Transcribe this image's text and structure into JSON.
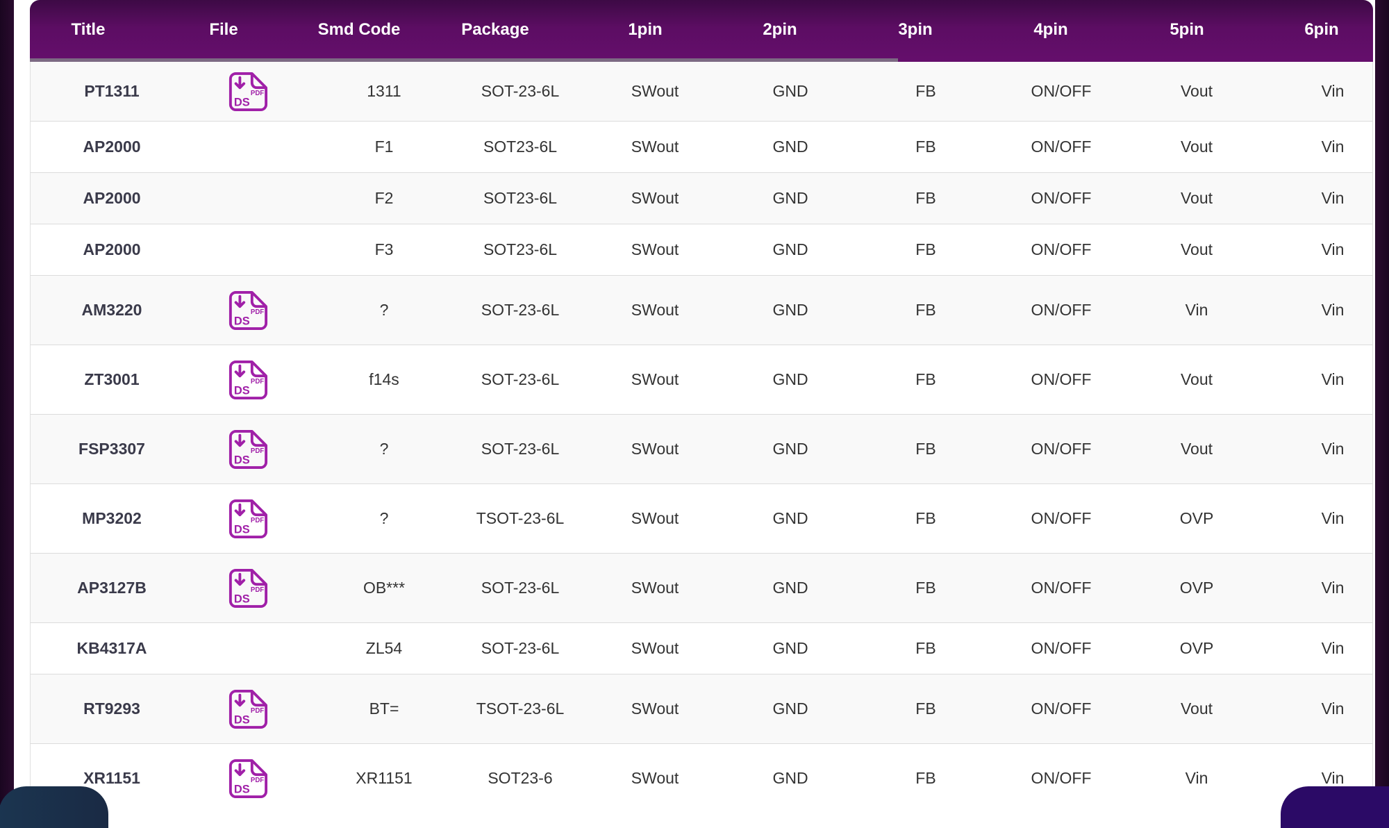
{
  "table": {
    "headers": [
      "Title",
      "File",
      "Smd Code",
      "Package",
      "1pin",
      "2pin",
      "3pin",
      "4pin",
      "5pin",
      "6pin"
    ],
    "file_icon": {
      "icon": "pdf-datasheet-download-icon",
      "label_top": "PDF",
      "label_bottom": "DS",
      "color": "#a020a8"
    },
    "rows": [
      {
        "title": "PT1311",
        "has_file": true,
        "smd": "1311",
        "package": "SOT-23-6L",
        "p1": "SWout",
        "p2": "GND",
        "p3": "FB",
        "p4": "ON/OFF",
        "p5": "Vout",
        "p6": "Vin"
      },
      {
        "title": "AP2000",
        "has_file": false,
        "smd": "F1",
        "package": "SOT23-6L",
        "p1": "SWout",
        "p2": "GND",
        "p3": "FB",
        "p4": "ON/OFF",
        "p5": "Vout",
        "p6": "Vin"
      },
      {
        "title": "AP2000",
        "has_file": false,
        "smd": "F2",
        "package": "SOT23-6L",
        "p1": "SWout",
        "p2": "GND",
        "p3": "FB",
        "p4": "ON/OFF",
        "p5": "Vout",
        "p6": "Vin"
      },
      {
        "title": "AP2000",
        "has_file": false,
        "smd": "F3",
        "package": "SOT23-6L",
        "p1": "SWout",
        "p2": "GND",
        "p3": "FB",
        "p4": "ON/OFF",
        "p5": "Vout",
        "p6": "Vin"
      },
      {
        "title": "AM3220",
        "has_file": true,
        "smd": "?",
        "package": "SOT-23-6L",
        "p1": "SWout",
        "p2": "GND",
        "p3": "FB",
        "p4": "ON/OFF",
        "p5": "Vin",
        "p6": "Vin"
      },
      {
        "title": "ZT3001",
        "has_file": true,
        "smd": "f14s",
        "package": "SOT-23-6L",
        "p1": "SWout",
        "p2": "GND",
        "p3": "FB",
        "p4": "ON/OFF",
        "p5": "Vout",
        "p6": "Vin"
      },
      {
        "title": "FSP3307",
        "has_file": true,
        "smd": "?",
        "package": "SOT-23-6L",
        "p1": "SWout",
        "p2": "GND",
        "p3": "FB",
        "p4": "ON/OFF",
        "p5": "Vout",
        "p6": "Vin"
      },
      {
        "title": "MP3202",
        "has_file": true,
        "smd": "?",
        "package": "TSOT-23-6L",
        "p1": "SWout",
        "p2": "GND",
        "p3": "FB",
        "p4": "ON/OFF",
        "p5": "OVP",
        "p6": "Vin"
      },
      {
        "title": "AP3127B",
        "has_file": true,
        "smd": "OB***",
        "package": "SOT-23-6L",
        "p1": "SWout",
        "p2": "GND",
        "p3": "FB",
        "p4": "ON/OFF",
        "p5": "OVP",
        "p6": "Vin"
      },
      {
        "title": "KB4317A",
        "has_file": false,
        "smd": "ZL54",
        "package": "SOT-23-6L",
        "p1": "SWout",
        "p2": "GND",
        "p3": "FB",
        "p4": "ON/OFF",
        "p5": "OVP",
        "p6": "Vin"
      },
      {
        "title": "RT9293",
        "has_file": true,
        "smd": "BT=",
        "package": "TSOT-23-6L",
        "p1": "SWout",
        "p2": "GND",
        "p3": "FB",
        "p4": "ON/OFF",
        "p5": "Vout",
        "p6": "Vin"
      },
      {
        "title": "XR1151",
        "has_file": true,
        "smd": "XR1151",
        "package": "SOT23-6",
        "p1": "SWout",
        "p2": "GND",
        "p3": "FB",
        "p4": "ON/OFF",
        "p5": "Vin",
        "p6": "Vin"
      }
    ]
  }
}
